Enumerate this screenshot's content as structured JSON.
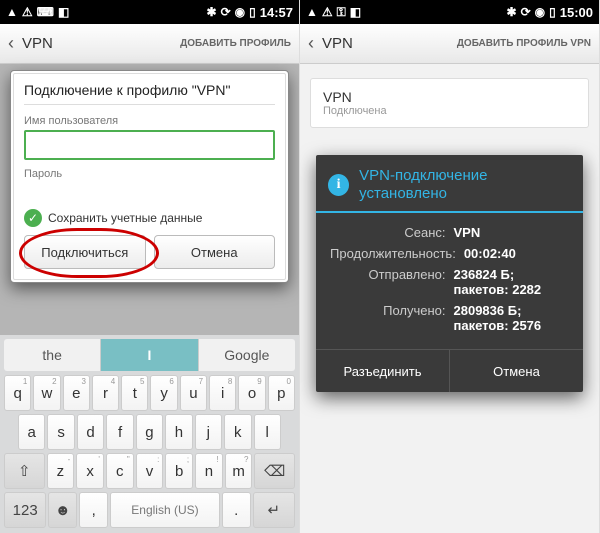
{
  "left": {
    "statusbar": {
      "time": "14:57"
    },
    "nav": {
      "title": "VPN",
      "action": "ДОБАВИТЬ ПРОФИЛЬ"
    },
    "dialog": {
      "title": "Подключение к профилю \"VPN\"",
      "username_label": "Имя пользователя",
      "username_value": "",
      "password_label": "Пароль",
      "save_credentials": "Сохранить учетные данные",
      "primary_btn": "Подключиться",
      "secondary_btn": "Отмена"
    },
    "keyboard": {
      "suggestions": [
        "the",
        "I",
        "Google"
      ],
      "row1": [
        "q",
        "w",
        "e",
        "r",
        "t",
        "y",
        "u",
        "i",
        "o",
        "p"
      ],
      "row2": [
        "a",
        "s",
        "d",
        "f",
        "g",
        "h",
        "j",
        "k",
        "l"
      ],
      "row3": [
        "z",
        "x",
        "c",
        "v",
        "b",
        "n",
        "m"
      ],
      "subs1": [
        "1",
        "2",
        "3",
        "4",
        "5",
        "6",
        "7",
        "8",
        "9",
        "0"
      ],
      "subs3": [
        "-",
        "'",
        "\"",
        ":",
        ";",
        "!",
        "?"
      ],
      "shift": "⇧",
      "backspace": "⌫",
      "num": "123",
      "comma": ",",
      "space": "English (US)",
      "period": ".",
      "enter": "↵",
      "emoji": "☻"
    }
  },
  "right": {
    "statusbar": {
      "time": "15:00"
    },
    "nav": {
      "title": "VPN",
      "action": "ДОБАВИТЬ ПРОФИЛЬ VPN"
    },
    "item": {
      "name": "VPN",
      "status": "Подключена"
    },
    "dialog": {
      "title": "VPN-подключение установлено",
      "rows": [
        {
          "label": "Сеанс:",
          "value": "VPN"
        },
        {
          "label": "Продолжительность:",
          "value": "00:02:40"
        },
        {
          "label": "Отправлено:",
          "value": "236824 Б; пакетов: 2282"
        },
        {
          "label": "Получено:",
          "value": "2809836 Б; пакетов: 2576"
        }
      ],
      "disconnect": "Разъединить",
      "cancel": "Отмена"
    }
  }
}
